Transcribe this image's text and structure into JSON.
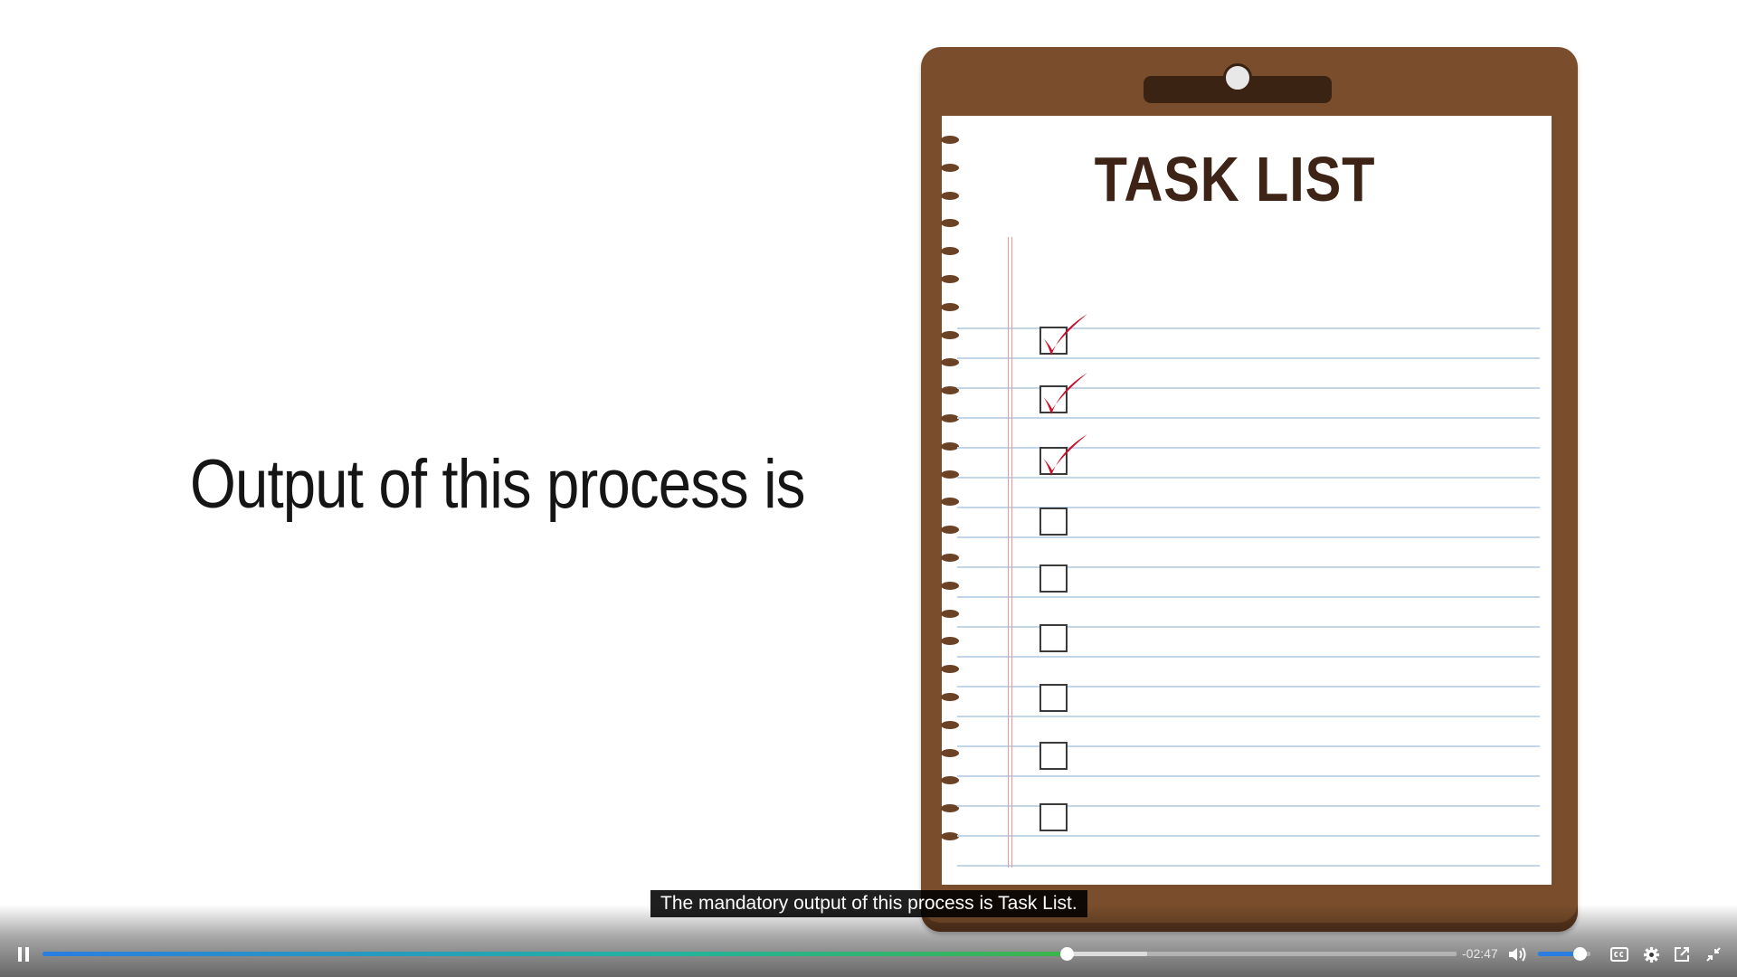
{
  "slide": {
    "headline": "Output of this process is",
    "task_list_title": "TASK LIST",
    "checked_boxes": 3,
    "total_boxes": 9
  },
  "caption": {
    "text": "The mandatory output of this process is Task List."
  },
  "player": {
    "state": "playing",
    "remaining_time": "-02:47",
    "progress_fraction": 0.724,
    "buffered_fraction": 0.781,
    "volume_fraction": 0.8,
    "icons": {
      "pause": "pause-icon",
      "volume": "volume-icon",
      "captions": "captions-icon",
      "settings": "gear-icon",
      "popout": "popout-icon",
      "exit_fullscreen": "exit-fullscreen-icon"
    },
    "accent_color": "#2a7de1"
  },
  "colors": {
    "clipboard": "#7a4e2c",
    "checkmark": "#c8102e",
    "title": "#3d2416"
  }
}
